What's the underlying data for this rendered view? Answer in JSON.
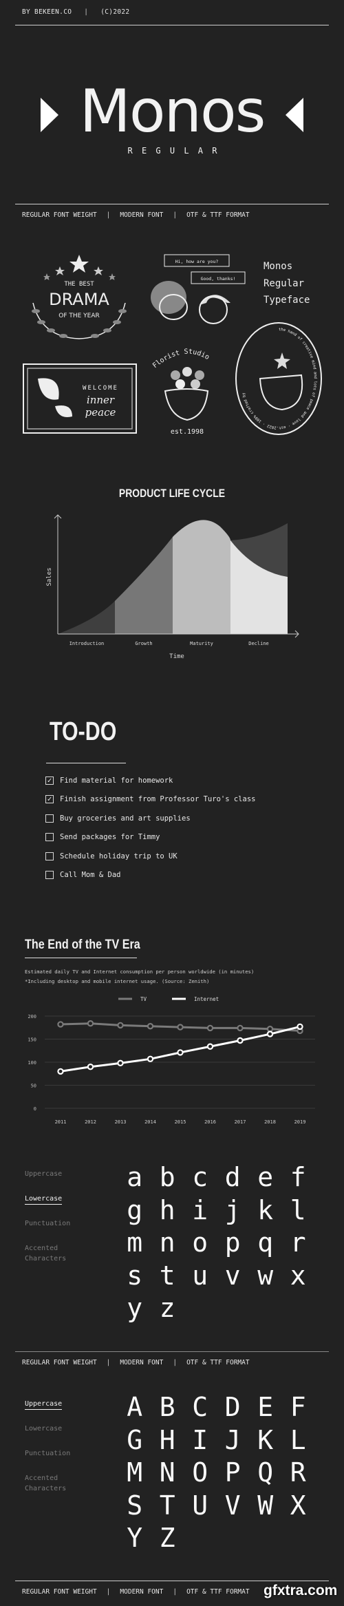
{
  "header": {
    "author": "BY BEKEEN.CO",
    "separator": "|",
    "copyright": "(C)2022"
  },
  "hero": {
    "title": "Monos",
    "subtitle": "R E G U L A R"
  },
  "info_bar": {
    "items": [
      "REGULAR FONT WEIGHT",
      "MODERN FONT",
      "OTF & TTF FORMAT"
    ],
    "separator": "|"
  },
  "showcase": {
    "drama_badge": {
      "top": "THE BEST",
      "main": "DRAMA",
      "bottom": "OF THE YEAR"
    },
    "bubbles": [
      "Hi, how are you?",
      "Good, thanks!"
    ],
    "typeface_lines": [
      "Monos",
      "Regular",
      "Typeface"
    ],
    "welcome": {
      "line1": "WELCOME",
      "line2": "inner",
      "line3": "peace"
    },
    "florist": {
      "name": "Florist Studio",
      "est": "est.1998"
    },
    "stamp_text": "the hand of creative mind and lots of peace and love · est.2022 · 100% crafted by"
  },
  "plc": {
    "title": "PRODUCT LIFE CYCLE",
    "ylabel": "Sales",
    "xlabel": "Time",
    "stages": [
      "Introduction",
      "Growth",
      "Maturity",
      "Decline"
    ],
    "stage_colors": [
      "#3f3f3f",
      "#777777",
      "#bdbdbd",
      "#e3e3e3"
    ]
  },
  "todo": {
    "title": "TO-DO",
    "items": [
      {
        "label": "Find material for homework",
        "checked": true
      },
      {
        "label": "Finish assignment from Professor Turo's class",
        "checked": true
      },
      {
        "label": "Buy groceries and art supplies",
        "checked": false
      },
      {
        "label": "Send packages for Timmy",
        "checked": false
      },
      {
        "label": "Schedule holiday trip to UK",
        "checked": false
      },
      {
        "label": "Call Mom & Dad",
        "checked": false
      }
    ],
    "check_glyph": "✓"
  },
  "chart_data": {
    "type": "line",
    "title": "The End of the TV Era",
    "subtitle": "Estimated daily TV and Internet consumption per person worldwide (in minutes)",
    "note": "*Including desktop and mobile internet usage. (Source: Zenith)",
    "x": [
      2011,
      2012,
      2013,
      2014,
      2015,
      2016,
      2017,
      2018,
      2019
    ],
    "series": [
      {
        "name": "TV",
        "color": "#7a7a7a",
        "values": [
          182,
          184,
          180,
          178,
          176,
          174,
          174,
          172,
          168
        ]
      },
      {
        "name": "Internet",
        "color": "#ffffff",
        "values": [
          80,
          90,
          98,
          107,
          121,
          134,
          147,
          161,
          177
        ]
      }
    ],
    "ylim": [
      0,
      200
    ],
    "yticks": [
      "200",
      "150",
      "100",
      "50",
      "0"
    ],
    "grid": true,
    "legend": "top-center"
  },
  "charset_lower": {
    "nav": [
      "Uppercase",
      "Lowercase",
      "Punctuation",
      "Accented Characters"
    ],
    "active": "Lowercase",
    "glyphs": [
      "a",
      "b",
      "c",
      "d",
      "e",
      "f",
      "g",
      "h",
      "i",
      "j",
      "k",
      "l",
      "m",
      "n",
      "o",
      "p",
      "q",
      "r",
      "s",
      "t",
      "u",
      "v",
      "w",
      "x",
      "y",
      "z"
    ]
  },
  "charset_upper": {
    "nav": [
      "Uppercase",
      "Lowercase",
      "Punctuation",
      "Accented Characters"
    ],
    "active": "Uppercase",
    "glyphs": [
      "A",
      "B",
      "C",
      "D",
      "E",
      "F",
      "G",
      "H",
      "I",
      "J",
      "K",
      "L",
      "M",
      "N",
      "O",
      "P",
      "Q",
      "R",
      "S",
      "T",
      "U",
      "V",
      "W",
      "X",
      "Y",
      "Z"
    ]
  },
  "watermark": "gfxtra.com"
}
